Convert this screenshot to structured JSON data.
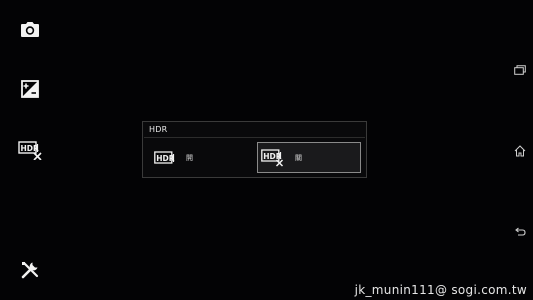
{
  "left_toolbar": {
    "items": [
      {
        "name": "camera-mode",
        "icon": "camera-icon"
      },
      {
        "name": "exposure",
        "icon": "exposure-compensation-icon"
      },
      {
        "name": "hdr",
        "icon": "hdr-off-icon"
      },
      {
        "name": "settings",
        "icon": "tools-icon"
      }
    ]
  },
  "hdr_panel": {
    "title": "HDR",
    "options": [
      {
        "label": "開",
        "icon": "hdr-on-icon",
        "selected": false
      },
      {
        "label": "關",
        "icon": "hdr-off-icon",
        "selected": true
      }
    ]
  },
  "nav_bar": {
    "items": [
      {
        "name": "recent-apps",
        "icon": "recent-apps-icon"
      },
      {
        "name": "home",
        "icon": "home-icon"
      },
      {
        "name": "back",
        "icon": "back-icon"
      }
    ]
  },
  "watermark": "jk_munin111@ sogi.com.tw",
  "colors": {
    "background": "#030305",
    "icon": "#ffffff",
    "panel_border": "#3a3a3a",
    "selected_border": "#8a8a8a"
  }
}
